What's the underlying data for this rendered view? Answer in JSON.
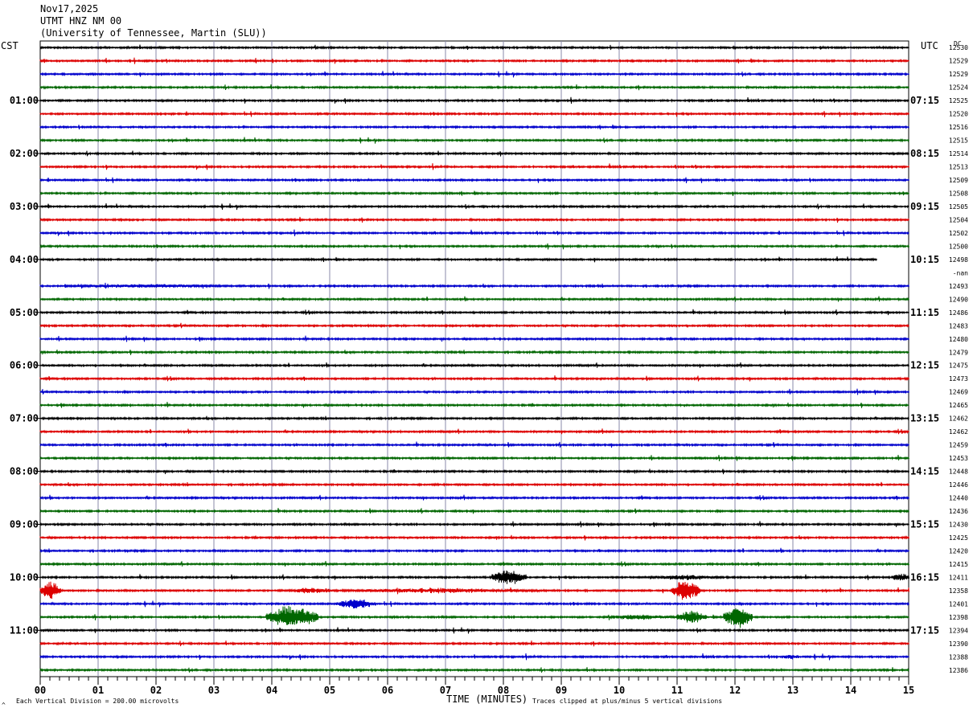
{
  "header": {
    "date": "Nov17,2025",
    "station": "UTMT HNZ NM 00",
    "network": "(University of Tennessee, Martin (SLU))"
  },
  "axis_labels": {
    "left_timezone": "CST",
    "right_timezone": "UTC",
    "dc_header": "DC",
    "x_title": "TIME (MINUTES)"
  },
  "footer": {
    "scale_note": "Each Vertical Division =  200.00 microvolts",
    "clip_note": "Traces clipped at plus/minus 5 vertical divisions",
    "corner_mark": "^"
  },
  "chart_data": {
    "type": "line",
    "title": "UTMT HNZ NM 00",
    "xlabel": "TIME (MINUTES)",
    "xlim": [
      0,
      15
    ],
    "x_ticks": [
      "00",
      "01",
      "02",
      "03",
      "04",
      "05",
      "06",
      "07",
      "08",
      "09",
      "10",
      "11",
      "12",
      "13",
      "14",
      "15"
    ],
    "left_hour_labels": [
      "01:00",
      "02:00",
      "03:00",
      "04:00",
      "05:00",
      "06:00",
      "07:00",
      "08:00",
      "09:00",
      "10:00",
      "11:00"
    ],
    "right_hour_labels": [
      "07:15",
      "08:15",
      "09:15",
      "10:15",
      "11:15",
      "12:15",
      "13:15",
      "14:15",
      "15:15",
      "16:15",
      "17:15"
    ],
    "dc_values": [
      "12530",
      "12529",
      "12529",
      "12524",
      "12525",
      "12520",
      "12516",
      "12515",
      "12514",
      "12513",
      "12509",
      "12508",
      "12505",
      "12504",
      "12502",
      "12500",
      "12498",
      "-nan",
      "12493",
      "12490",
      "12486",
      "12483",
      "12480",
      "12479",
      "12475",
      "12473",
      "12469",
      "12465",
      "12462",
      "12462",
      "12459",
      "12453",
      "12448",
      "12446",
      "12440",
      "12436",
      "12430",
      "12425",
      "12420",
      "12415",
      "12411",
      "12358",
      "12401",
      "12398",
      "12394",
      "12390",
      "12388",
      "12386"
    ],
    "trace_colors": [
      "#000000",
      "#dd0000",
      "#0000cc",
      "#006600"
    ],
    "traces_per_hour": 4,
    "trace_count": 48,
    "missing_trace_index": 17,
    "partial_trace": {
      "index": 16,
      "end_minute": 14.45
    },
    "events": [
      {
        "trace": 18,
        "start": 0.4,
        "end": 3.3,
        "amplitude": 0.35
      },
      {
        "trace": 40,
        "start": 7.8,
        "end": 8.4,
        "amplitude": 1.4
      },
      {
        "trace": 40,
        "start": 10.5,
        "end": 11.8,
        "amplitude": 0.5
      },
      {
        "trace": 40,
        "start": 14.7,
        "end": 15.0,
        "amplitude": 0.9
      },
      {
        "trace": 41,
        "start": 0.0,
        "end": 0.35,
        "amplitude": 1.7
      },
      {
        "trace": 41,
        "start": 4.3,
        "end": 5.1,
        "amplitude": 0.6
      },
      {
        "trace": 41,
        "start": 5.2,
        "end": 8.7,
        "amplitude": 0.45
      },
      {
        "trace": 41,
        "start": 10.9,
        "end": 11.4,
        "amplitude": 2.0
      },
      {
        "trace": 42,
        "start": 5.1,
        "end": 5.8,
        "amplitude": 1.0
      },
      {
        "trace": 43,
        "start": 3.9,
        "end": 4.8,
        "amplitude": 2.2
      },
      {
        "trace": 43,
        "start": 9.7,
        "end": 11.0,
        "amplitude": 0.5
      },
      {
        "trace": 43,
        "start": 11.0,
        "end": 11.5,
        "amplitude": 1.2
      },
      {
        "trace": 43,
        "start": 11.8,
        "end": 12.3,
        "amplitude": 2.0
      },
      {
        "trace": 46,
        "start": 12.8,
        "end": 13.1,
        "amplitude": 0.5
      }
    ]
  }
}
